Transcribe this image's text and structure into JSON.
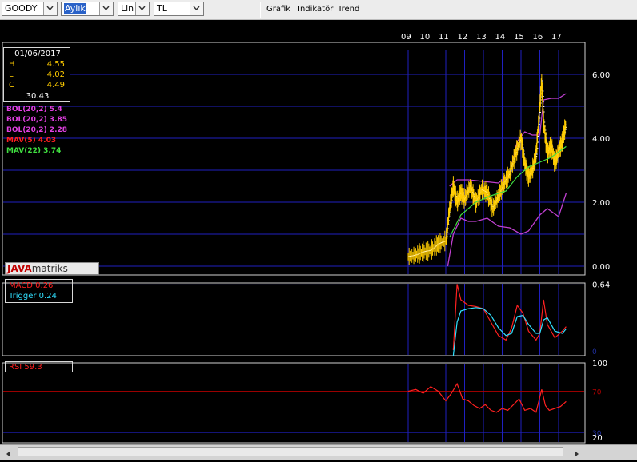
{
  "toolbar": {
    "symbol": "GOODY",
    "period": "Aylık",
    "scale": "Lin",
    "currency": "TL",
    "menu": [
      "Grafik",
      "Indikatör",
      "Trend"
    ]
  },
  "info": {
    "date": "01/06/2017",
    "high_label": "H",
    "high": "4.55",
    "low_label": "L",
    "low": "4.02",
    "close_label": "C",
    "close": "4.49",
    "volume": "30.43"
  },
  "legend": [
    {
      "text": "BOL(20,2) 5.4",
      "color": "#e040e0"
    },
    {
      "text": "BOL(20,2) 3.85",
      "color": "#e040e0"
    },
    {
      "text": "BOL(20,2) 2.28",
      "color": "#e040e0"
    },
    {
      "text": "MAV(5) 4.03",
      "color": "#ff2020"
    },
    {
      "text": "MAV(22) 3.74",
      "color": "#40e040"
    }
  ],
  "logo": {
    "java": "JAVA",
    "rest": "matriks"
  },
  "macd_box": {
    "macd": "MACD 0.26",
    "trigger": "Trigger 0.24"
  },
  "rsi_box": {
    "rsi": "RSI 59.3"
  },
  "colors": {
    "grid": "#2020c0",
    "bars": "#ffcc00",
    "boll": "#c040d0",
    "ma5": "#ff3030",
    "ma22": "#40e040",
    "macd": "#ff2020",
    "trigger": "#30e0ff",
    "rsi": "#ff2020"
  },
  "chart_data": {
    "type": "line",
    "x_labels": [
      "09",
      "10",
      "11",
      "12",
      "13",
      "14",
      "15",
      "16",
      "17"
    ],
    "price_axis": [
      "6.00",
      "4.00",
      "2.00",
      "0.00"
    ],
    "macd_axis": [
      "0.64",
      "0"
    ],
    "rsi_axis": [
      "100",
      "70",
      "30",
      "20"
    ],
    "series": [
      {
        "name": "Price",
        "x": [
          9.0,
          9.4,
          9.8,
          10.2,
          10.6,
          11.0,
          11.2,
          11.4,
          11.6,
          11.8,
          12.0,
          12.3,
          12.6,
          12.9,
          13.2,
          13.5,
          13.8,
          14.1,
          14.4,
          14.7,
          15.0,
          15.2,
          15.4,
          15.6,
          15.8,
          16.0,
          16.1,
          16.2,
          16.4,
          16.6,
          16.8,
          17.0,
          17.2,
          17.4
        ],
        "values": [
          0.3,
          0.35,
          0.45,
          0.5,
          0.7,
          0.8,
          1.8,
          2.5,
          2.0,
          2.3,
          2.1,
          2.5,
          2.0,
          2.4,
          2.3,
          1.8,
          2.2,
          2.6,
          2.9,
          3.5,
          4.0,
          3.2,
          2.8,
          3.0,
          3.5,
          5.0,
          5.8,
          4.5,
          3.5,
          3.8,
          3.2,
          3.6,
          3.9,
          4.49
        ]
      },
      {
        "name": "MACD",
        "x": [
          11.4,
          11.6,
          11.8,
          12.2,
          12.6,
          13.0,
          13.4,
          13.8,
          14.2,
          14.5,
          14.8,
          15.1,
          15.4,
          15.8,
          16.0,
          16.2,
          16.4,
          16.8,
          17.2,
          17.4
        ],
        "values": [
          0.05,
          0.64,
          0.5,
          0.45,
          0.44,
          0.42,
          0.3,
          0.18,
          0.14,
          0.25,
          0.45,
          0.38,
          0.22,
          0.14,
          0.2,
          0.5,
          0.28,
          0.16,
          0.22,
          0.26
        ]
      },
      {
        "name": "Trigger",
        "x": [
          11.4,
          11.6,
          11.8,
          12.2,
          12.6,
          13.0,
          13.4,
          13.8,
          14.2,
          14.5,
          14.8,
          15.1,
          15.4,
          15.8,
          16.0,
          16.2,
          16.4,
          16.8,
          17.2,
          17.4
        ],
        "values": [
          0.0,
          0.3,
          0.4,
          0.42,
          0.43,
          0.42,
          0.36,
          0.25,
          0.18,
          0.2,
          0.35,
          0.36,
          0.28,
          0.2,
          0.2,
          0.32,
          0.34,
          0.22,
          0.2,
          0.24
        ]
      },
      {
        "name": "RSI",
        "x": [
          9.0,
          9.4,
          9.8,
          10.2,
          10.6,
          11.0,
          11.3,
          11.6,
          11.9,
          12.2,
          12.5,
          12.8,
          13.1,
          13.4,
          13.7,
          14.0,
          14.3,
          14.6,
          14.9,
          15.2,
          15.5,
          15.8,
          16.1,
          16.3,
          16.5,
          16.8,
          17.1,
          17.4
        ],
        "values": [
          70,
          72,
          68,
          75,
          70,
          60,
          68,
          78,
          62,
          60,
          55,
          52,
          56,
          50,
          48,
          52,
          50,
          56,
          62,
          50,
          52,
          48,
          72,
          55,
          50,
          52,
          54,
          59.3
        ]
      }
    ]
  }
}
